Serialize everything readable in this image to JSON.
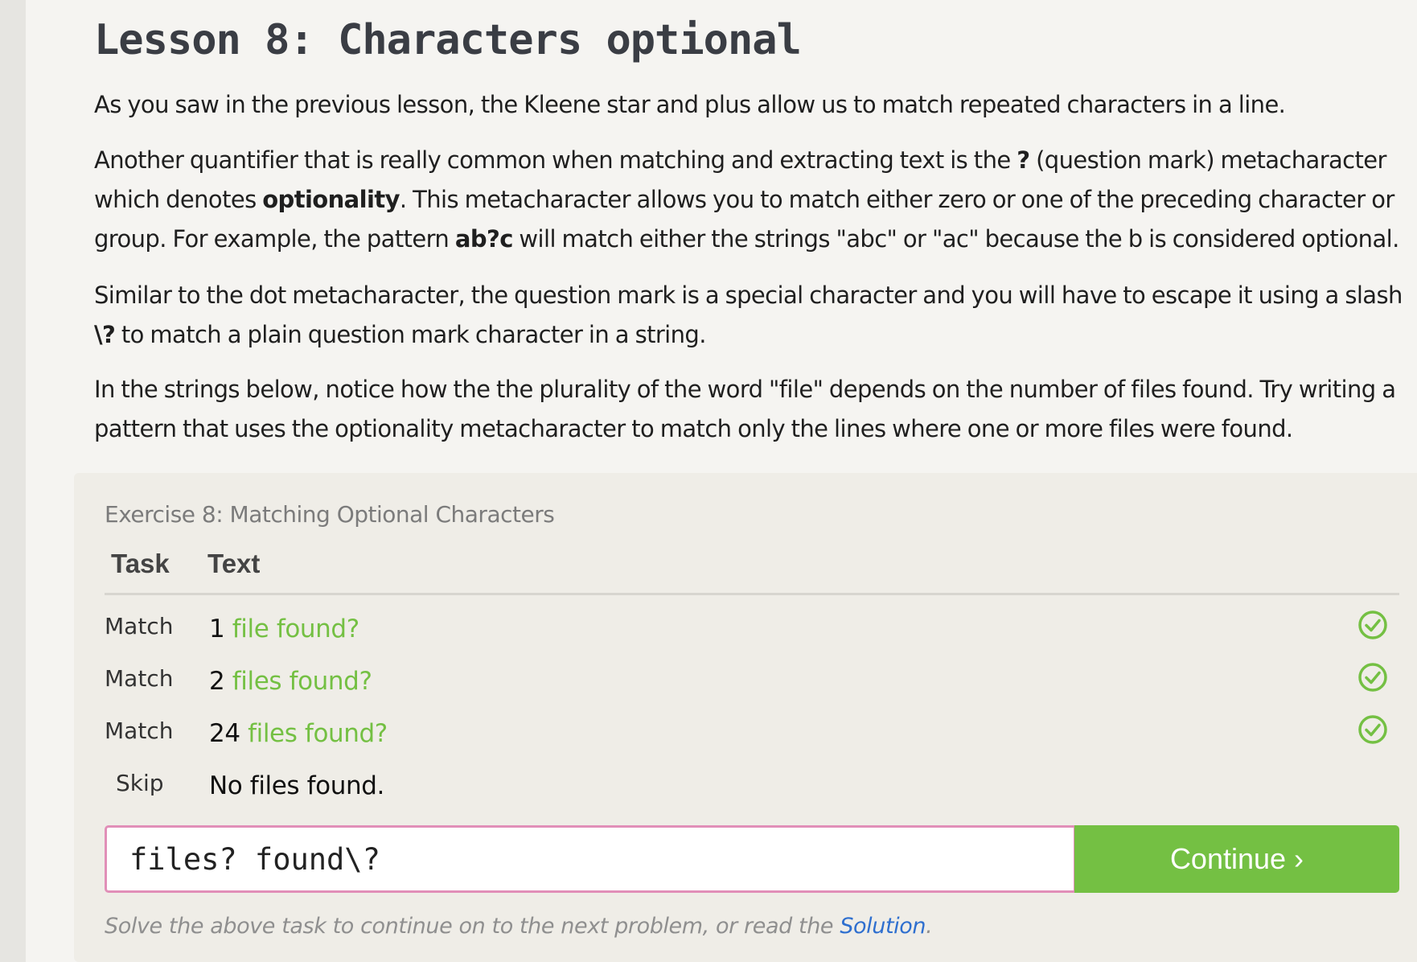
{
  "lesson": {
    "title": "Lesson 8: Characters optional",
    "p1": "As you saw in the previous lesson, the Kleene star and plus allow us to match repeated characters in a line.",
    "p2": {
      "a": "Another quantifier that is really common when matching and extracting text is the ",
      "b": "?",
      "c": " (question mark) metacharacter which denotes ",
      "d": "optionality",
      "e": ". This metacharacter allows you to match either zero or one of the preceding character or group. For example, the pattern ",
      "f": "ab?c",
      "g": " will match either the strings \"abc\" or \"ac\" because the b is considered optional."
    },
    "p3": {
      "a": "Similar to the dot metacharacter, the question mark is a special character and you will have to escape it using a slash ",
      "b": "\\?",
      "c": " to match a plain question mark character in a string."
    },
    "p4": "In the strings below, notice how the the plurality of the word \"file\" depends on the number of files found. Try writing a pattern that uses the optionality metacharacter to match only the lines where one or more files were found."
  },
  "exercise": {
    "title": "Exercise 8: Matching Optional Characters",
    "headers": {
      "task": "Task",
      "text": "Text"
    },
    "rows": [
      {
        "task": "Match",
        "prefix": "1 ",
        "match": "file found?",
        "suffix": "",
        "status": "check-icon"
      },
      {
        "task": "Match",
        "prefix": "2 ",
        "match": "files found?",
        "suffix": "",
        "status": "check-icon"
      },
      {
        "task": "Match",
        "prefix": "24 ",
        "match": "files found?",
        "suffix": "",
        "status": "check-icon"
      },
      {
        "task": "Skip",
        "prefix": "No files found.",
        "match": "",
        "suffix": "",
        "status": ""
      }
    ],
    "input_value": "files? found\\?",
    "continue_label": "Continue ›",
    "hint_prefix": "Solve the above task to continue on to the next problem, or read the ",
    "hint_link": "Solution",
    "hint_suffix": "."
  },
  "colors": {
    "accent_green": "#74c043",
    "input_border": "#e18fb8",
    "link_blue": "#2e6fcf"
  }
}
